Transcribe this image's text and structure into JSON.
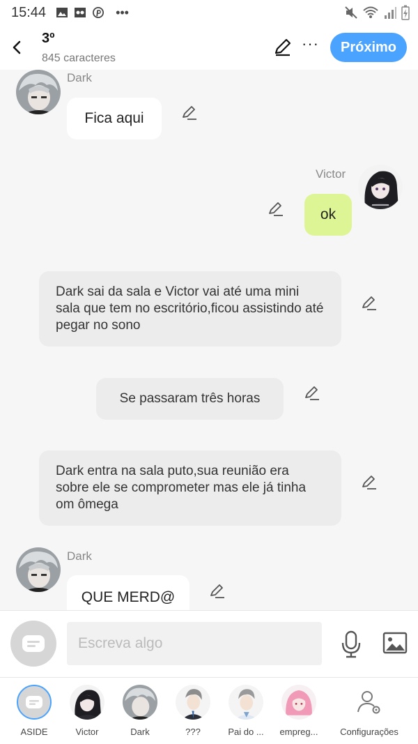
{
  "status_bar": {
    "time": "15:44",
    "left_icons": [
      "image-icon",
      "voicemail-icon",
      "pinterest-icon",
      "more-dots-icon"
    ],
    "right_icons": [
      "mute-icon",
      "wifi-icon",
      "signal-icon",
      "battery-charging-icon"
    ]
  },
  "header": {
    "title": "3º",
    "subtitle": "845 caracteres",
    "next_label": "Próximo"
  },
  "messages": [
    {
      "sender": "Dark",
      "text": "Fica aqui"
    },
    {
      "sender": "Victor",
      "text": "ok"
    },
    {
      "text": "Dark sai da sala e Victor vai até uma mini sala que tem no escritório,ficou assistindo até pegar no sono"
    },
    {
      "text": "Se passaram três horas"
    },
    {
      "text": "Dark entra na sala puto,sua reunião era sobre ele se comprometer mas ele já tinha om ômega"
    },
    {
      "sender": "Dark",
      "text": "QUE MERD@"
    }
  ],
  "input": {
    "placeholder": "Escreva algo"
  },
  "tabs": [
    {
      "label": "ASIDE"
    },
    {
      "label": "Victor"
    },
    {
      "label": "Dark"
    },
    {
      "label": "???"
    },
    {
      "label": "Pai do ..."
    },
    {
      "label": "empreg..."
    },
    {
      "label": "Configurações"
    }
  ],
  "colors": {
    "accent": "#4aa3ff",
    "my_bubble": "#ddf595",
    "other_bubble": "#ffffff",
    "narration": "#ececec",
    "background": "#f6f6f6"
  }
}
